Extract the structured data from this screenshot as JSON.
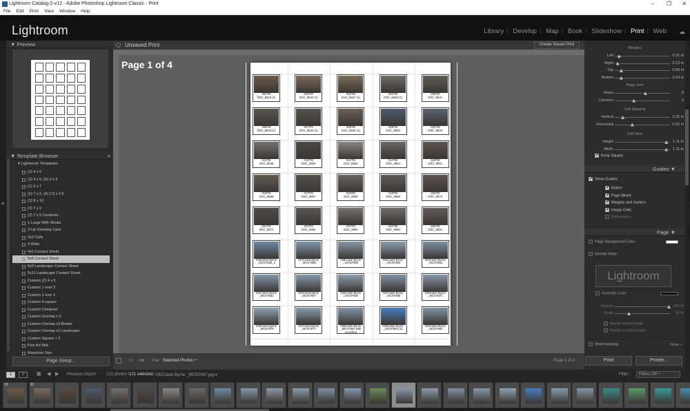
{
  "window": {
    "title": "Lightroom Catalog-2-v12 - Adobe Photoshop Lightroom Classic - Print",
    "controls": [
      "–",
      "❐",
      "✕"
    ]
  },
  "menu": [
    "File",
    "Edit",
    "Print",
    "View",
    "Window",
    "Help"
  ],
  "app": {
    "logo": "Lightroom",
    "modules": [
      {
        "label": "Library"
      },
      {
        "label": "Develop"
      },
      {
        "label": "Map"
      },
      {
        "label": "Book"
      },
      {
        "label": "Slideshow"
      },
      {
        "label": "Print",
        "active": true
      },
      {
        "label": "Web"
      }
    ]
  },
  "left": {
    "preview_header": "Preview",
    "template_header": "Template Browser",
    "template_folder": "Lightroom Templates",
    "templates": [
      "(1) 4 x 6",
      "(1) 4 x 6, (6) 2 x 3",
      "(1) 5 x 7",
      "(1) 7 x 5, (4) 2.5 x 3.5",
      "(1) 8 x 10",
      "(2) 7 x 5",
      "(2) 7 x 5 Centered",
      "1 Large With Stroke",
      "2-Up Greeting Card",
      "2x2 Cells",
      "4 Wide",
      "4x5 Contact Sheet",
      "5x8 Contact Sheet",
      "5x9 Landscape Contact Sheet",
      "5x11 Landscape Contact Sheet",
      "Custom (2) 4 x 6",
      "Custom 1 over 2",
      "Custom 2 over 1",
      "Custom 4 square",
      "Custom Centered",
      "Custom Overlap x 3",
      "Custom Overlap x3 Border",
      "Custom Overlap x3 Landscape",
      "Custom Square + 2",
      "Fine Art Mat",
      "Maximize Size"
    ],
    "selected_template": "5x8 Contact Sheet",
    "page_setup": "Page Setup..."
  },
  "center": {
    "print_name": "Unsaved Print",
    "create_saved": "Create Saved Print",
    "page_label": "Page 1 of 4",
    "use_label": "Use :",
    "use_value": "Selected Photos",
    "page_counter": "Page 1 of 4",
    "cells": [
      {
        "cap1": "001TM",
        "cap2": "DSC_8620 (1)",
        "c": "#6b5a4a"
      },
      {
        "cap1": "002TM",
        "cap2": "DSC_8626 (1)",
        "c": "#7a6a5e"
      },
      {
        "cap1": "003TM",
        "cap2": "DSC_8627 (1)",
        "c": "#7d6e5a"
      },
      {
        "cap1": "004TM",
        "cap2": "DSC_8628 (1)",
        "c": "#6e6a66"
      },
      {
        "cap1": "005TM",
        "cap2": "DSC_8631",
        "c": "#5f5b56"
      },
      {
        "cap1": "006TM",
        "cap2": "DSC_8633 (1)",
        "c": "#595650"
      },
      {
        "cap1": "007TM",
        "cap2": "DSC_8634 (1)",
        "c": "#56524e"
      },
      {
        "cap1": "008TM",
        "cap2": "DSC_8636 (1)",
        "c": "#6a5f55"
      },
      {
        "cap1": "009TM",
        "cap2": "DSC_8643",
        "c": "#4d5b6e"
      },
      {
        "cap1": "010TM",
        "cap2": "DSC_8645",
        "c": "#5a6270"
      },
      {
        "cap1": "011TM",
        "cap2": "DSC_8649",
        "c": "#75706b"
      },
      {
        "cap1": "012TM",
        "cap2": "DSC_8650",
        "c": "#4d4743"
      },
      {
        "cap1": "013TM",
        "cap2": "DSC_8652",
        "c": "#8a867f"
      },
      {
        "cap1": "014TM",
        "cap2": "DSC_8654",
        "c": "#6c6762"
      },
      {
        "cap1": "015TM",
        "cap2": "DSC_8661",
        "c": "#5c554f"
      },
      {
        "cap1": "016TM",
        "cap2": "DSC_8666",
        "c": "#635b52"
      },
      {
        "cap1": "017TM",
        "cap2": "DSC_8667",
        "c": "#57514c"
      },
      {
        "cap1": "018TM",
        "cap2": "DSC_8668",
        "c": "#6a6560"
      },
      {
        "cap1": "019TM",
        "cap2": "DSC_8669",
        "c": "#625c57"
      },
      {
        "cap1": "020TM",
        "cap2": "DSC_8670",
        "c": "#5d5650"
      },
      {
        "cap1": "021TM",
        "cap2": "DSC_8672",
        "c": "#4e4945"
      },
      {
        "cap1": "022TM",
        "cap2": "DSC_8682",
        "c": "#5a5550"
      },
      {
        "cap1": "023TM",
        "cap2": "DSC_8685",
        "c": "#77716c"
      },
      {
        "cap1": "024TM",
        "cap2": "DSC_8690",
        "c": "#6f6964"
      },
      {
        "cap1": "025TM",
        "cap2": "DSC_8691",
        "c": "#625c56"
      },
      {
        "cap1": "026Caleb Byrne",
        "cap2": "_MCN7856_1",
        "c": "#6f8aa5"
      },
      {
        "cap1": "027Caleb Byrne",
        "cap2": "_MCN7858",
        "c": "#8297ad"
      },
      {
        "cap1": "028Caleb Byrne",
        "cap2": "_MCN7859",
        "c": "#8a98a8"
      },
      {
        "cap1": "029Caleb Byrne",
        "cap2": "_MCN7860",
        "c": "#8b9cae"
      },
      {
        "cap1": "030Caleb Byrne",
        "cap2": "_MCN7861",
        "c": "#7d8ea2"
      },
      {
        "cap1": "031Caleb Byrne",
        "cap2": "_MCN7862",
        "c": "#8496aa"
      },
      {
        "cap1": "032Caleb Byrne",
        "cap2": "_MCN7867",
        "c": "#8899ab"
      },
      {
        "cap1": "033Caleb Byrne",
        "cap2": "_MCN7868",
        "c": "#8c9bab"
      },
      {
        "cap1": "034Caleb Byrne",
        "cap2": "_MCN7869",
        "c": "#7f90a3"
      },
      {
        "cap1": "035Caleb Byrne",
        "cap2": "_MCN7872",
        "c": "#8797a9"
      },
      {
        "cap1": "036Caleb Byrne",
        "cap2": "_MCN7876",
        "c": "#90a0b0"
      },
      {
        "cap1": "037Caleb Byrne",
        "cap2": "_MCN7877",
        "c": "#8a9aac"
      },
      {
        "cap1": "038Caleb Byrne",
        "cap2": "_MCN7884 with recording",
        "c": "#8393a6"
      },
      {
        "cap1": "039Caleb Byrne",
        "cap2": "_MCN7884 (1)",
        "c": "#4a7cc0"
      },
      {
        "cap1": "040Caleb Byrne",
        "cap2": "_MCN7884",
        "c": "#7f8fa2"
      }
    ]
  },
  "right": {
    "margins_title": "Margins",
    "margins": [
      {
        "label": "Left",
        "value": "0.31 in",
        "pos": 0.05
      },
      {
        "label": "Right",
        "value": "0.13 in",
        "pos": 0.02
      },
      {
        "label": "Top",
        "value": "0.56 in",
        "pos": 0.09
      },
      {
        "label": "Bottom",
        "value": "0.54 in",
        "pos": 0.09
      }
    ],
    "grid_title": "Page Grid",
    "grid": [
      {
        "label": "Rows",
        "value": "8",
        "pos": 0.55
      },
      {
        "label": "Columns",
        "value": "5",
        "pos": 0.33
      }
    ],
    "spacing_title": "Cell Spacing",
    "spacing": [
      {
        "label": "Vertical",
        "value": "0.25 in",
        "pos": 0.12
      },
      {
        "label": "Horizontal",
        "value": "0.62 in",
        "pos": 0.3
      }
    ],
    "size_title": "Cell Size",
    "size": [
      {
        "label": "Height",
        "value": "1.11 in",
        "pos": 0.95
      },
      {
        "label": "Width",
        "value": "1.11 in",
        "pos": 0.95
      }
    ],
    "keep_square": "Keep Square",
    "guides_header": "Guides",
    "show_guides": "Show Guides",
    "guides": [
      {
        "label": "Rulers",
        "on": true
      },
      {
        "label": "Page Bleed",
        "on": true
      },
      {
        "label": "Margins and Gutters",
        "on": true
      },
      {
        "label": "Image Cells",
        "on": true
      },
      {
        "label": "Dimensions",
        "on": false
      }
    ],
    "page_header": "Page",
    "page_bg": "Page Background Color",
    "identity_plate": "Identity Plate",
    "plate_text": "Lightroom",
    "override_color": "Override Color",
    "opacity_label": "Opacity",
    "opacity_value": "100 %",
    "scale_label": "Scale",
    "scale_value": "25 %",
    "render_behind": "Render behind image",
    "render_every": "Render on every image",
    "watermarking": "Watermarking",
    "watermark_value": "None ÷",
    "print_btn": "Print",
    "printer_btn": "Printer..."
  },
  "filmstrip": {
    "tab1": "1",
    "tab2": "2",
    "source": "Previous Import",
    "count": "121 photos /",
    "selected": "121 selected",
    "file": "/ 032Caleb Byrne _MCN7867.jpg",
    "filter_label": "Filter :",
    "filter_value": "Filters Off",
    "thumbs": [
      {
        "n": "19",
        "c": "#6b5a4a"
      },
      {
        "n": "20",
        "c": "#7a6a5e"
      },
      {
        "n": "",
        "c": "#5a4a3c"
      },
      {
        "n": "",
        "c": "#4d5b6e"
      },
      {
        "n": "",
        "c": "#75706b"
      },
      {
        "n": "",
        "c": "#4d4743"
      },
      {
        "n": "",
        "c": "#8a867f"
      },
      {
        "n": "",
        "c": "#6c6762"
      },
      {
        "n": "",
        "c": "#6f8aa5"
      },
      {
        "n": "",
        "c": "#8297ad"
      },
      {
        "n": "",
        "c": "#8a98a8"
      },
      {
        "n": "",
        "c": "#8b9cae"
      },
      {
        "n": "",
        "c": "#7d8ea2"
      },
      {
        "n": "",
        "c": "#8496aa"
      },
      {
        "n": "",
        "c": "#6b8a5a"
      },
      {
        "n": "",
        "c": "#8899ab"
      },
      {
        "n": "",
        "c": "#8c9bab"
      },
      {
        "n": "",
        "c": "#7f90a3"
      },
      {
        "n": "",
        "c": "#8797a9"
      },
      {
        "n": "",
        "c": "#90a0b0"
      },
      {
        "n": "",
        "c": "#4a7cc0"
      },
      {
        "n": "",
        "c": "#8a9aac"
      },
      {
        "n": "",
        "c": "#8393a6"
      },
      {
        "n": "",
        "c": "#3c8a8a"
      },
      {
        "n": "",
        "c": "#5a9a6a"
      },
      {
        "n": "",
        "c": "#3a9a9a"
      },
      {
        "n": "",
        "c": "#4c8cb0"
      }
    ]
  }
}
